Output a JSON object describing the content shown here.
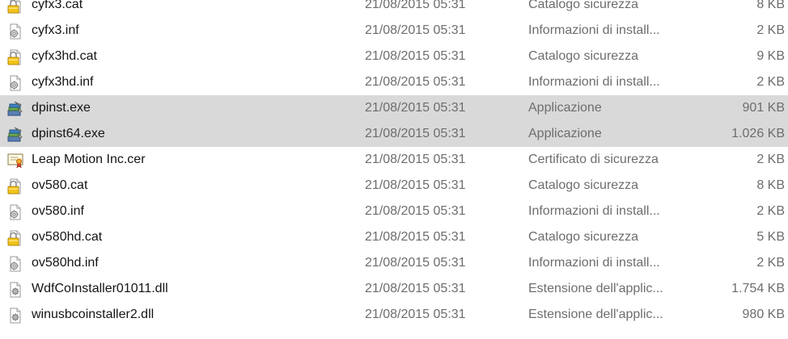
{
  "files": [
    {
      "name": "cyfx3.cat",
      "date": "21/08/2015 05:31",
      "type": "Catalogo sicurezza",
      "size": "8 KB",
      "icon": "security-catalog-icon",
      "selected": false
    },
    {
      "name": "cyfx3.inf",
      "date": "21/08/2015 05:31",
      "type": "Informazioni di install...",
      "size": "2 KB",
      "icon": "setup-info-icon",
      "selected": false
    },
    {
      "name": "cyfx3hd.cat",
      "date": "21/08/2015 05:31",
      "type": "Catalogo sicurezza",
      "size": "9 KB",
      "icon": "security-catalog-icon",
      "selected": false
    },
    {
      "name": "cyfx3hd.inf",
      "date": "21/08/2015 05:31",
      "type": "Informazioni di install...",
      "size": "2 KB",
      "icon": "setup-info-icon",
      "selected": false
    },
    {
      "name": "dpinst.exe",
      "date": "21/08/2015 05:31",
      "type": "Applicazione",
      "size": "901 KB",
      "icon": "installer-app-icon",
      "selected": true
    },
    {
      "name": "dpinst64.exe",
      "date": "21/08/2015 05:31",
      "type": "Applicazione",
      "size": "1.026 KB",
      "icon": "installer-app-icon",
      "selected": true
    },
    {
      "name": "Leap Motion Inc.cer",
      "date": "21/08/2015 05:31",
      "type": "Certificato di sicurezza",
      "size": "2 KB",
      "icon": "certificate-icon",
      "selected": false
    },
    {
      "name": "ov580.cat",
      "date": "21/08/2015 05:31",
      "type": "Catalogo sicurezza",
      "size": "8 KB",
      "icon": "security-catalog-icon",
      "selected": false
    },
    {
      "name": "ov580.inf",
      "date": "21/08/2015 05:31",
      "type": "Informazioni di install...",
      "size": "2 KB",
      "icon": "setup-info-icon",
      "selected": false
    },
    {
      "name": "ov580hd.cat",
      "date": "21/08/2015 05:31",
      "type": "Catalogo sicurezza",
      "size": "5 KB",
      "icon": "security-catalog-icon",
      "selected": false
    },
    {
      "name": "ov580hd.inf",
      "date": "21/08/2015 05:31",
      "type": "Informazioni di install...",
      "size": "2 KB",
      "icon": "setup-info-icon",
      "selected": false
    },
    {
      "name": "WdfCoInstaller01011.dll",
      "date": "21/08/2015 05:31",
      "type": "Estensione dell'applic...",
      "size": "1.754 KB",
      "icon": "dll-gear-icon",
      "selected": false
    },
    {
      "name": "winusbcoinstaller2.dll",
      "date": "21/08/2015 05:31",
      "type": "Estensione dell'applic...",
      "size": "980 KB",
      "icon": "dll-gear-icon",
      "selected": false
    }
  ]
}
